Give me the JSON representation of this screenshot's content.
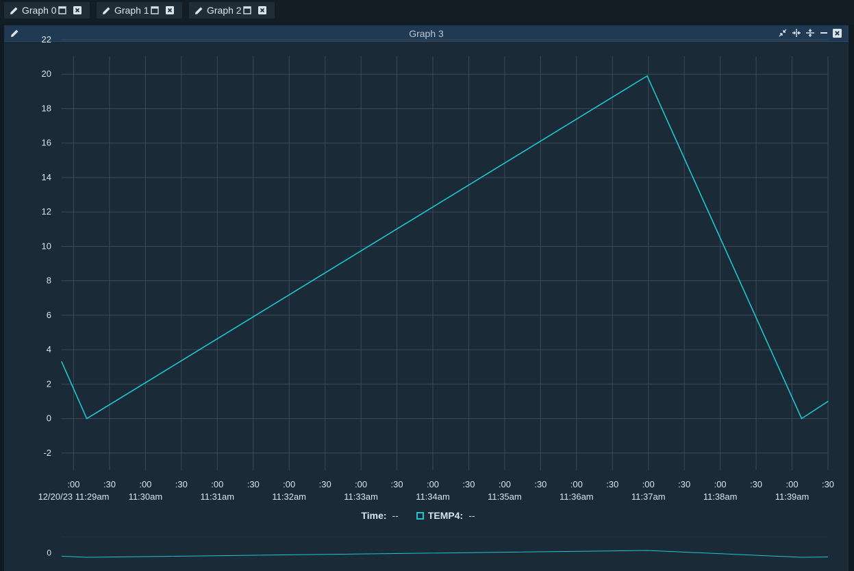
{
  "tabs": [
    {
      "label": "Graph 0"
    },
    {
      "label": "Graph 1"
    },
    {
      "label": "Graph 2"
    }
  ],
  "panel": {
    "title": "Graph 3"
  },
  "legend": {
    "time_label": "Time:",
    "time_value": "--",
    "series_label": "TEMP4:",
    "series_value": "--"
  },
  "colors": {
    "series": "#1cc7cf",
    "grid": "#3a4a58",
    "background": "#1a2a37",
    "header": "#1f3a52"
  },
  "icons": [
    "pencil-icon",
    "maximize-icon",
    "close-icon",
    "collapse-icon",
    "fit-horizontal-icon",
    "fit-vertical-icon",
    "minimize-icon"
  ],
  "chart_data": {
    "type": "line",
    "title": "",
    "xlabel": "",
    "ylabel": "",
    "ylim": [
      -3,
      22
    ],
    "yticks": [
      -2,
      0,
      2,
      4,
      6,
      8,
      10,
      12,
      14,
      16,
      18,
      20,
      22
    ],
    "x_range_seconds": [
      "11:28:50",
      "11:39:30"
    ],
    "xticks": [
      {
        "time": "11:29:00",
        "top": ":00",
        "bottom": "12/20/23 11:29am"
      },
      {
        "time": "11:29:30",
        "top": ":30",
        "bottom": ""
      },
      {
        "time": "11:30:00",
        "top": ":00",
        "bottom": "11:30am"
      },
      {
        "time": "11:30:30",
        "top": ":30",
        "bottom": ""
      },
      {
        "time": "11:31:00",
        "top": ":00",
        "bottom": "11:31am"
      },
      {
        "time": "11:31:30",
        "top": ":30",
        "bottom": ""
      },
      {
        "time": "11:32:00",
        "top": ":00",
        "bottom": "11:32am"
      },
      {
        "time": "11:32:30",
        "top": ":30",
        "bottom": ""
      },
      {
        "time": "11:33:00",
        "top": ":00",
        "bottom": "11:33am"
      },
      {
        "time": "11:33:30",
        "top": ":30",
        "bottom": ""
      },
      {
        "time": "11:34:00",
        "top": ":00",
        "bottom": "11:34am"
      },
      {
        "time": "11:34:30",
        "top": ":30",
        "bottom": ""
      },
      {
        "time": "11:35:00",
        "top": ":00",
        "bottom": "11:35am"
      },
      {
        "time": "11:35:30",
        "top": ":30",
        "bottom": ""
      },
      {
        "time": "11:36:00",
        "top": ":00",
        "bottom": "11:36am"
      },
      {
        "time": "11:36:30",
        "top": ":30",
        "bottom": ""
      },
      {
        "time": "11:37:00",
        "top": ":00",
        "bottom": "11:37am"
      },
      {
        "time": "11:37:30",
        "top": ":30",
        "bottom": ""
      },
      {
        "time": "11:38:00",
        "top": ":00",
        "bottom": "11:38am"
      },
      {
        "time": "11:38:30",
        "top": ":30",
        "bottom": ""
      },
      {
        "time": "11:39:00",
        "top": ":00",
        "bottom": "11:39am"
      },
      {
        "time": "11:39:30",
        "top": ":30",
        "bottom": ""
      }
    ],
    "series": [
      {
        "name": "TEMP4",
        "points": [
          {
            "x": "11:28:50",
            "y": 3.3
          },
          {
            "x": "11:29:11",
            "y": 0.0
          },
          {
            "x": "11:36:59",
            "y": 19.9
          },
          {
            "x": "11:39:08",
            "y": 0.0
          },
          {
            "x": "11:39:30",
            "y": 1.0
          }
        ]
      }
    ],
    "overview": {
      "yticks": [
        0
      ]
    },
    "grid": true
  }
}
